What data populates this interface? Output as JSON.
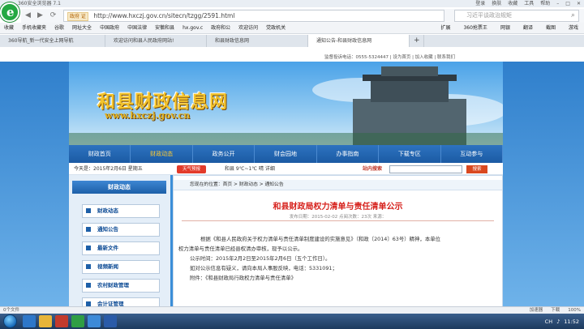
{
  "browser": {
    "title": "360安全浏览器 7.1",
    "window_buttons": [
      "登录",
      "换肤",
      "收藏",
      "工具",
      "帮助"
    ],
    "url_badge": "政府 证",
    "url": "http://www.hxczj.gov.cn/sitecn/tzgg/2591.html",
    "search_placeholder": "习近平谈政治规矩",
    "bookmarks": [
      "收藏",
      "手机收藏夹",
      "谷歌",
      "网址大全",
      "中国政府",
      "中国法律",
      "安徽和县",
      "hx.gov.c",
      "政府和公",
      "欢迎访问",
      "党政机关"
    ],
    "bookmark_tools": [
      "扩展",
      "360抢票王",
      "网银",
      "翻译",
      "截图",
      "游戏"
    ],
    "tabs": [
      "360导航_新一代安全上网导航",
      "欢迎访问和县人民政府网站!",
      "和县财政信息网",
      "通知公告-和县财政信息网"
    ],
    "status_left": "0个文件",
    "status_right": [
      "加速器",
      "下载",
      "100%"
    ]
  },
  "site": {
    "top_links": "监督投诉电话：0555-5324447  |  设为首页  |  加入收藏  |  联系我们",
    "title": "和县财政信息网",
    "url_text": "www.hxczj.gov.cn",
    "nav": [
      "财政首页",
      "财政动态",
      "政务公开",
      "财会园地",
      "办事指南",
      "下载专区",
      "互动参与"
    ],
    "date_text": "今天是：2015年2月6日  星期五",
    "weather_btn": "天气预报",
    "weather_text": "和县  9℃~1℃  晴  详细",
    "search_label": "站内搜索",
    "search_btn": "搜索",
    "left_header": "财政动态",
    "left_items": [
      "财政动态",
      "通知公告",
      "最新文件",
      "视频新闻",
      "农村财政管理",
      "会计证管理"
    ],
    "breadcrumb": "您现在的位置：首页  >  财政动态  >  通知公告"
  },
  "article": {
    "title": "和县财政局权力清单与责任清单公示",
    "meta": "发布日期：2015-02-02    点阅次数：23次    来源：",
    "p1": "根据《和县人民政府关于权力清单与责任清单制度建设的实施意见》（和政〔2014〕63号）精神，本单位",
    "p2": "权力清单与责任清单已经县权清办审核，现予以公示。",
    "p3": "公示时间：2015年2月2日至2015年2月6日（五个工作日）。",
    "p4": "如对公示信息有疑义，请向本局人事股反映，电话：5331091；",
    "p5": "附件：《和县财政局行政权力清单与责任清单》"
  },
  "taskbar": {
    "time": "11:52",
    "lang": "CH"
  }
}
